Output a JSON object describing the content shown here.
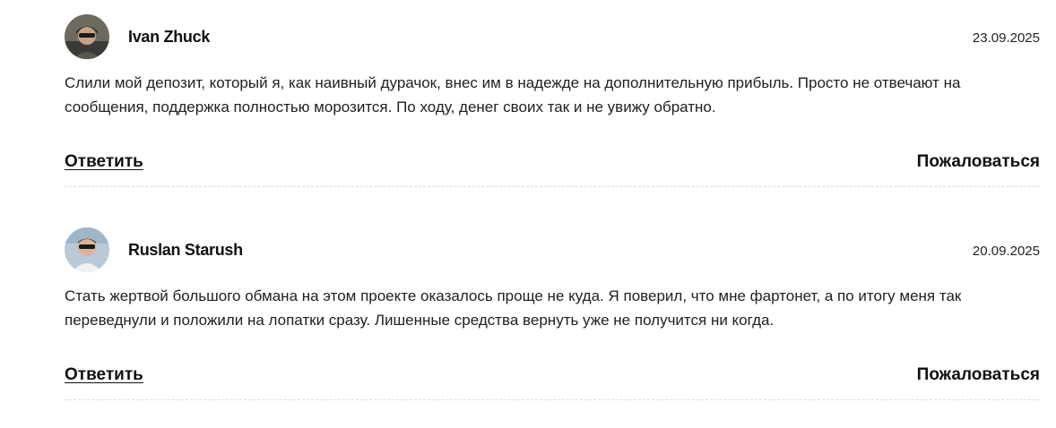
{
  "comments": [
    {
      "author": "Ivan Zhuck",
      "date": "23.09.2025",
      "text": "Слили мой депозит, который я, как наивный дурачок, внес им в надежде на дополнительную прибыль. Просто не отвечают на сообщения, поддержка полностью морозится. По ходу, денег своих так и не увижу обратно.",
      "reply_label": "Ответить",
      "report_label": "Пожаловаться",
      "avatar_icon": "user-photo-avatar"
    },
    {
      "author": "Ruslan Starush",
      "date": "20.09.2025",
      "text": "Стать жертвой большого обмана на этом проекте оказалось проще не куда. Я поверил, что мне фартонет, а по итогу меня так переведнули и положили на лопатки сразу. Лишенные средства вернуть уже не получится ни когда.",
      "reply_label": "Ответить",
      "report_label": "Пожаловаться",
      "avatar_icon": "user-photo-avatar"
    }
  ],
  "colors": {
    "text": "#1f1f1f",
    "divider": "#dcdcdc"
  }
}
